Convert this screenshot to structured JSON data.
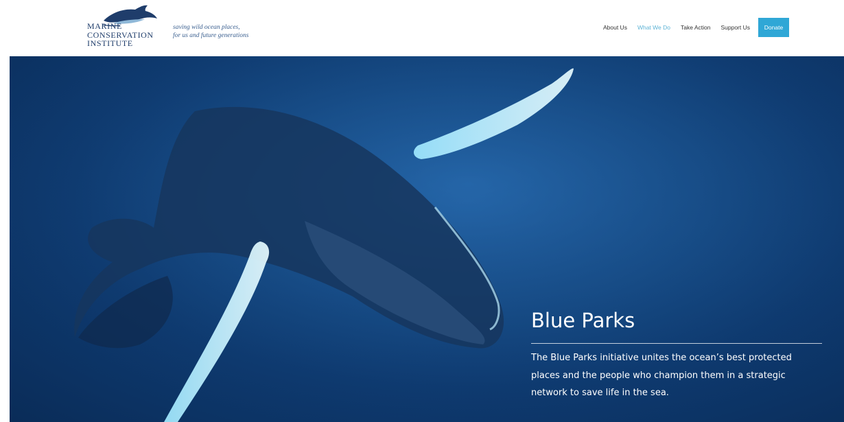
{
  "header": {
    "logo": {
      "lines": [
        "Marine",
        "Conservation",
        "Institute"
      ],
      "icon": "dolphin-icon"
    },
    "tagline": {
      "line1": "saving wild ocean places,",
      "line2": "for us and future generations"
    },
    "nav": {
      "about": "About Us",
      "what_we_do": "What We Do",
      "take_action": "Take Action",
      "support": "Support Us",
      "donate": "Donate"
    }
  },
  "hero": {
    "title": "Blue Parks",
    "description": "The Blue Parks initiative unites the ocean’s best protected places and the people who champion them in a strategic network to save life in the sea.",
    "image": "humpback-whale-underwater"
  },
  "colors": {
    "brand_navy": "#1f3d6b",
    "accent_blue": "#2fa7d6",
    "active_link": "#5fb4d6",
    "ocean": "#154a85"
  }
}
